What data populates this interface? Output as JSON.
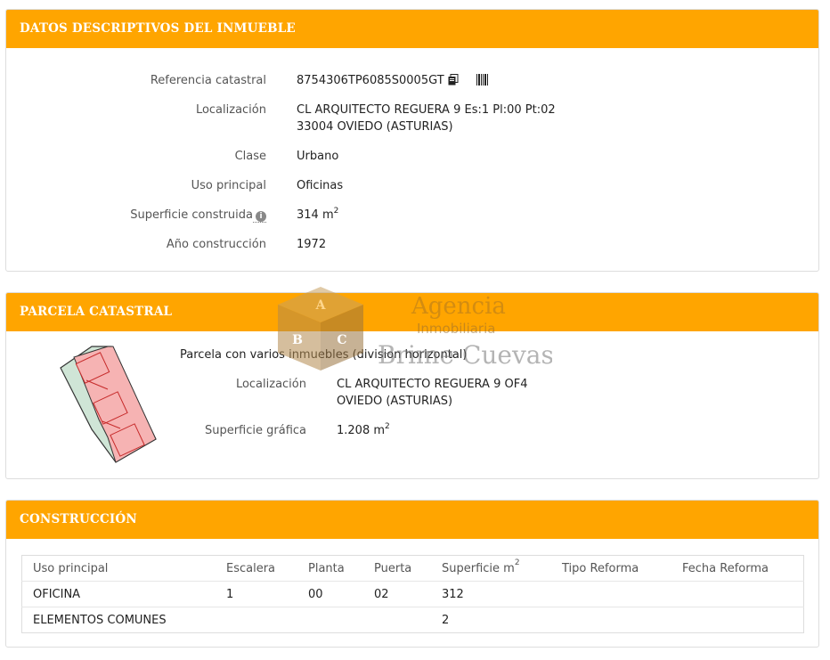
{
  "datos": {
    "title": "DATOS DESCRIPTIVOS DEL INMUEBLE",
    "ref_label": "Referencia catastral",
    "ref_value": "8754306TP6085S0005GT",
    "loc_label": "Localización",
    "loc_line1": "CL ARQUITECTO REGUERA 9 Es:1 Pl:00 Pt:02",
    "loc_line2": "33004 OVIEDO (ASTURIAS)",
    "clase_label": "Clase",
    "clase_value": "Urbano",
    "uso_label": "Uso principal",
    "uso_value": "Oficinas",
    "sup_label": "Superficie construida",
    "sup_value": "314 m",
    "sup_unit_exp": "2",
    "anio_label": "Año construcción",
    "anio_value": "1972"
  },
  "parcela": {
    "title": "PARCELA CATASTRAL",
    "desc": "Parcela con varios inmuebles (division horizontal)",
    "loc_label": "Localización",
    "loc_line1": "CL ARQUITECTO REGUERA 9 OF4",
    "loc_line2": "OVIEDO (ASTURIAS)",
    "sup_label": "Superficie gráfica",
    "sup_value": "1.208 m",
    "sup_unit_exp": "2"
  },
  "construccion": {
    "title": "CONSTRUCCIÓN",
    "headers": [
      "Uso principal",
      "Escalera",
      "Planta",
      "Puerta",
      "Superficie m",
      "Tipo Reforma",
      "Fecha Reforma"
    ],
    "sup_header_exp": "2",
    "rows": [
      [
        "OFICINA",
        "1",
        "00",
        "02",
        "312",
        "",
        ""
      ],
      [
        "ELEMENTOS COMUNES",
        "",
        "",
        "",
        "2",
        "",
        ""
      ]
    ]
  },
  "watermark": {
    "line1": "Agencia",
    "line2": "Inmobiliaria",
    "line3": "Brime Cuevas",
    "cube_top": "A",
    "cube_left": "B",
    "cube_right": "C"
  },
  "colors": {
    "header": "#ffa500",
    "parcel_fill": "#f6b3b3",
    "parcel_green": "#cfe5d6"
  }
}
